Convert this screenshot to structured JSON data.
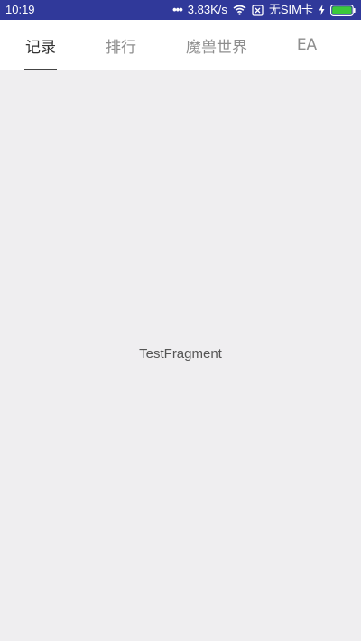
{
  "status_bar": {
    "time": "10:19",
    "speed": "3.83K/s",
    "sim_text": "无SIM卡",
    "dots": "•••",
    "icons": [
      "wifi-icon",
      "no-sim-icon",
      "charging-icon",
      "battery-icon"
    ],
    "battery_color": "#3cc83c",
    "bg_color": "#30399a"
  },
  "tabs": {
    "items": [
      {
        "label": "记录",
        "active": true
      },
      {
        "label": "排行",
        "active": false
      },
      {
        "label": "魔兽世界",
        "active": false
      },
      {
        "label": "EA",
        "active": false
      }
    ]
  },
  "content": {
    "text": "TestFragment"
  }
}
